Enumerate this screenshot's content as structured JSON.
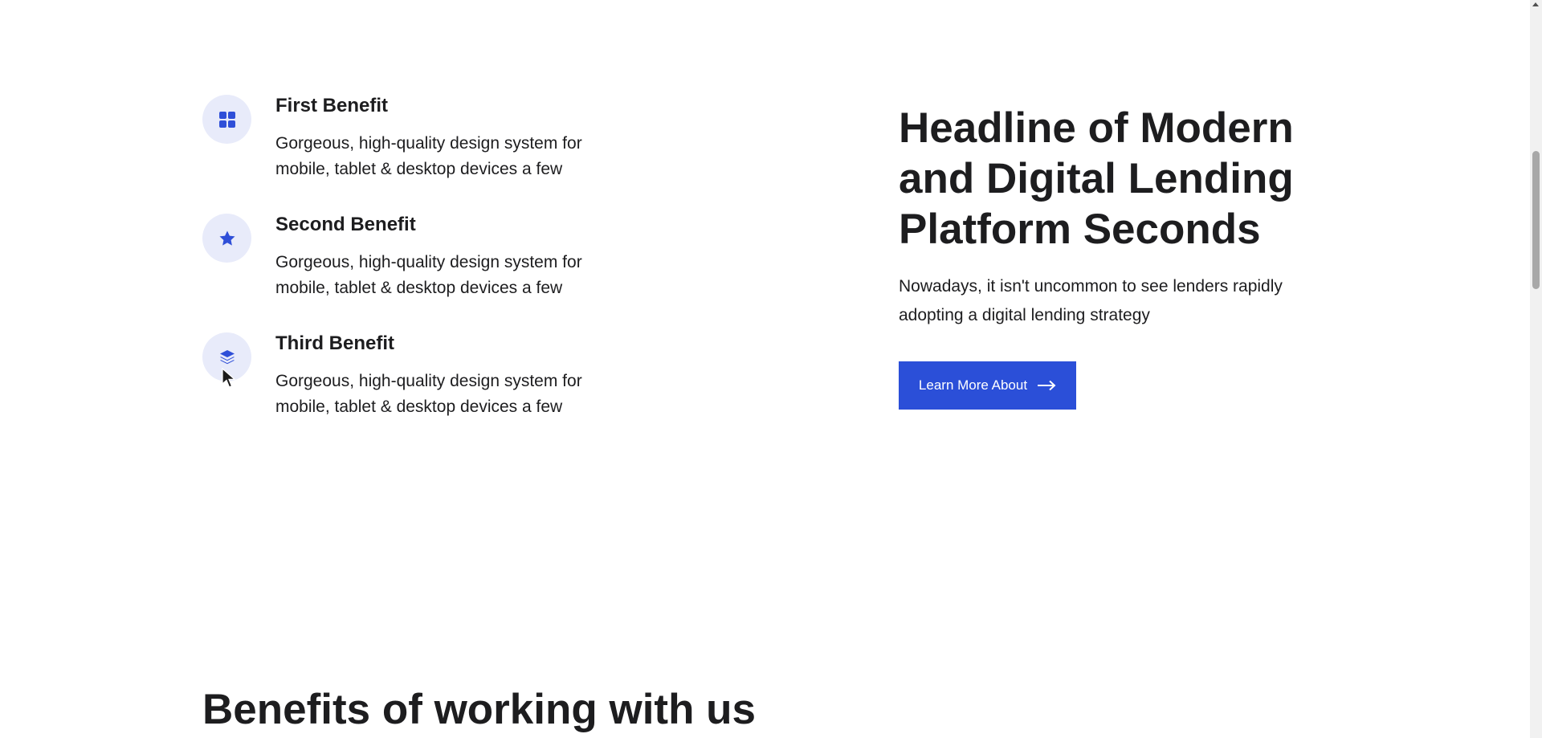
{
  "benefits": [
    {
      "title": "First Benefit",
      "text": "Gorgeous, high-quality design system for mobile, tablet & desktop devices a few",
      "icon": "grid-icon"
    },
    {
      "title": "Second Benefit",
      "text": "Gorgeous, high-quality design system for mobile, tablet & desktop devices a few",
      "icon": "star-icon"
    },
    {
      "title": "Third Benefit",
      "text": "Gorgeous, high-quality design system for mobile, tablet & desktop devices a few",
      "icon": "layers-icon"
    }
  ],
  "hero": {
    "headline": "Headline of Modern and Digital Lending Platform Seconds",
    "subtext": "Nowadays, it isn't uncommon to see lenders rapidly adopting a digital lending strategy",
    "cta_label": "Learn More About",
    "cta_icon": "arrow-right-icon"
  },
  "next_section": {
    "heading": "Benefits of working with us"
  },
  "colors": {
    "accent": "#2b4fd8",
    "icon_bg": "#e8ebfa",
    "text": "#1d1d1f"
  }
}
